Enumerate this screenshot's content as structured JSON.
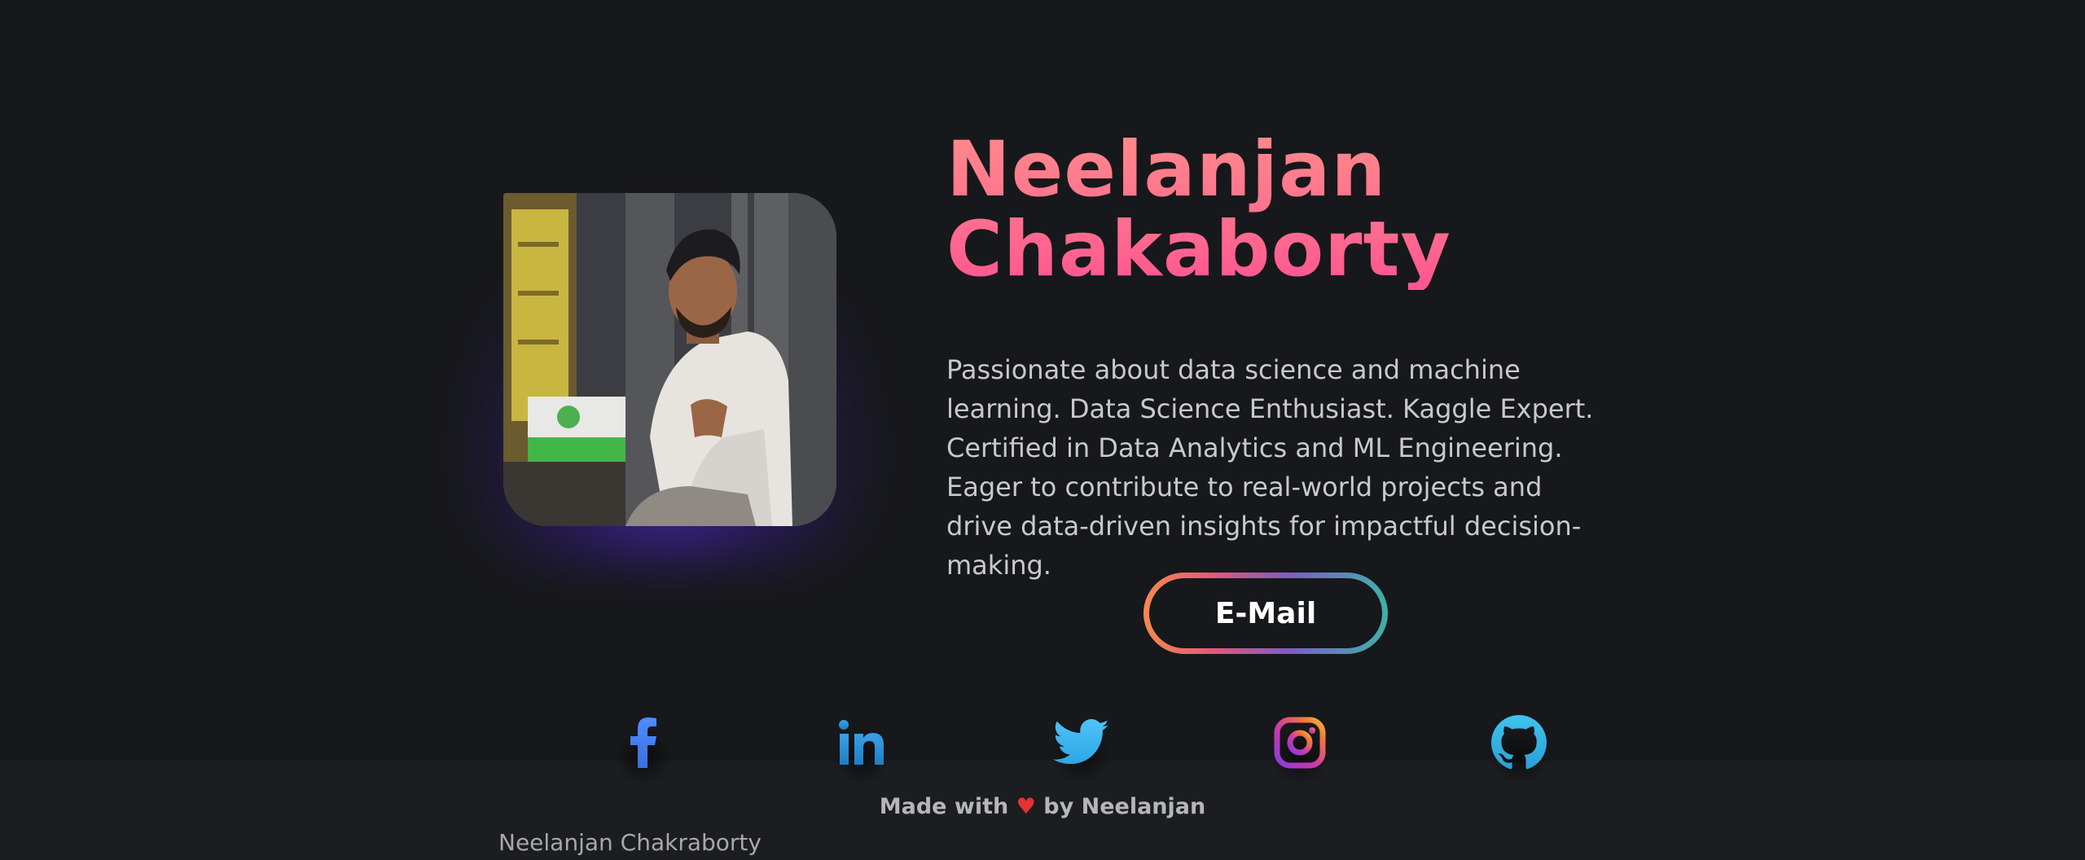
{
  "profile": {
    "name_line1": "Neelanjan",
    "name_line2": "Chakaborty",
    "bio": "Passionate about data science and machine learning. Data Science Enthusiast. Kaggle Expert. Certified in Data Analytics and ML Engineering. Eager to contribute to real-world projects and drive data-driven insights for impactful decision-making.",
    "email_label": "E-Mail"
  },
  "social": {
    "items": [
      {
        "name": "facebook-icon",
        "color": "#4b86ff"
      },
      {
        "name": "linkedin-icon",
        "color": "#2f8fd8"
      },
      {
        "name": "twitter-icon",
        "color": "#3fb4f2"
      },
      {
        "name": "instagram-icon",
        "color": "#c23fc5"
      },
      {
        "name": "github-icon",
        "color": "#34b8e6"
      }
    ]
  },
  "footer": {
    "made_with_prefix": "Made with",
    "heart": "♥",
    "made_with_suffix": "by Neelanjan",
    "copyright": "Neelanjan Chakraborty"
  },
  "colors": {
    "background": "#17181b",
    "name_gradient_top": "#ff8a8a",
    "name_gradient_bottom": "#ff5590",
    "photo_glow": "#5830dc"
  }
}
